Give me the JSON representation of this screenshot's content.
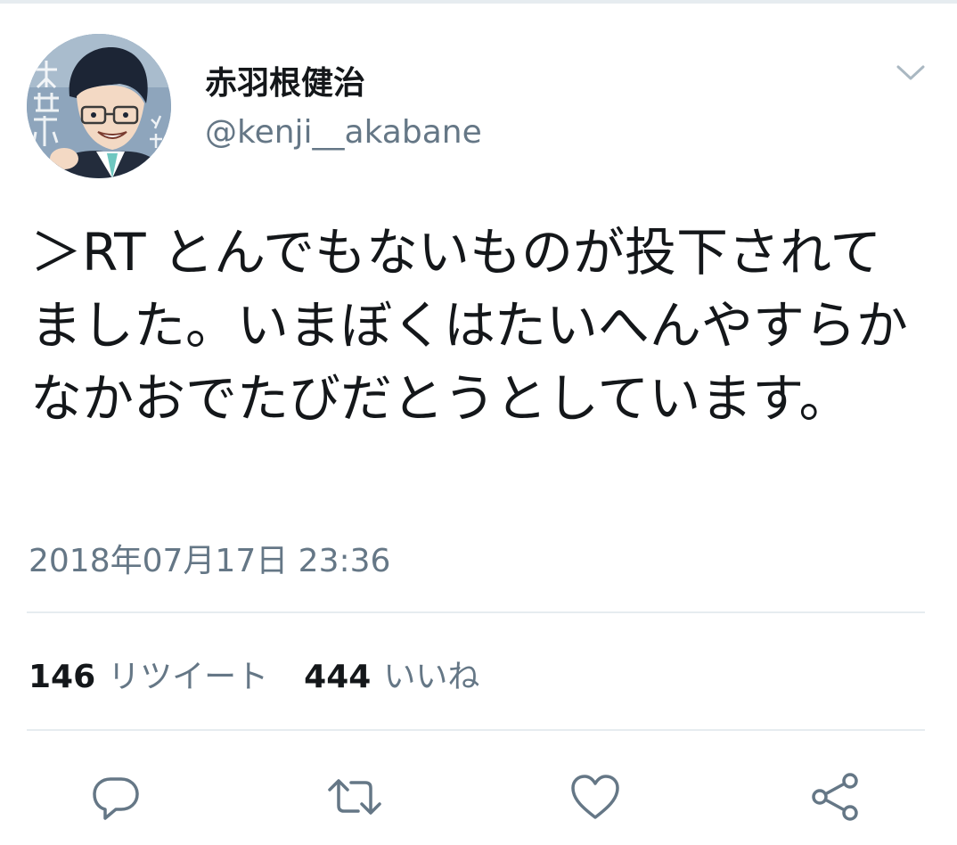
{
  "tweet": {
    "display_name": "赤羽根健治",
    "handle": "@kenji__akabane",
    "text": "＞RT とんでもないものが投下されてました。いまぼくはたいへんやすらかなかおでたびだとうとしています。",
    "timestamp": "2018年07月17日 23:36",
    "retweets": {
      "count": "146",
      "label": "リツイート"
    },
    "likes": {
      "count": "444",
      "label": "いいね"
    }
  },
  "icons": {
    "menu": "chevron-down-icon",
    "reply": "reply-icon",
    "retweet": "retweet-icon",
    "like": "heart-icon",
    "share": "share-icon"
  },
  "colors": {
    "text": "#14171a",
    "secondary_text": "#657786",
    "divider": "#e6ecf0",
    "icon": "#657786"
  }
}
